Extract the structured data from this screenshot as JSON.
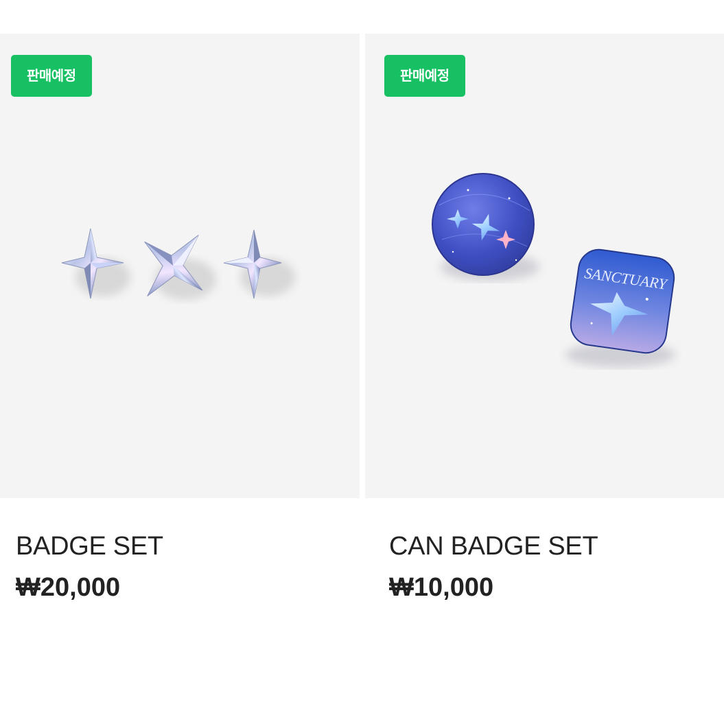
{
  "products": [
    {
      "badge": "판매예정",
      "name": "BADGE SET",
      "price": "₩20,000",
      "image_icon": "star-badge-set-icon"
    },
    {
      "badge": "판매예정",
      "name": "CAN BADGE SET",
      "price": "₩10,000",
      "image_icon": "can-badge-set-icon",
      "badge_art_text": "SANCTUARY"
    }
  ],
  "colors": {
    "badge_bg": "#17c163",
    "thumb_bg": "#f4f4f4",
    "text": "#222222"
  }
}
